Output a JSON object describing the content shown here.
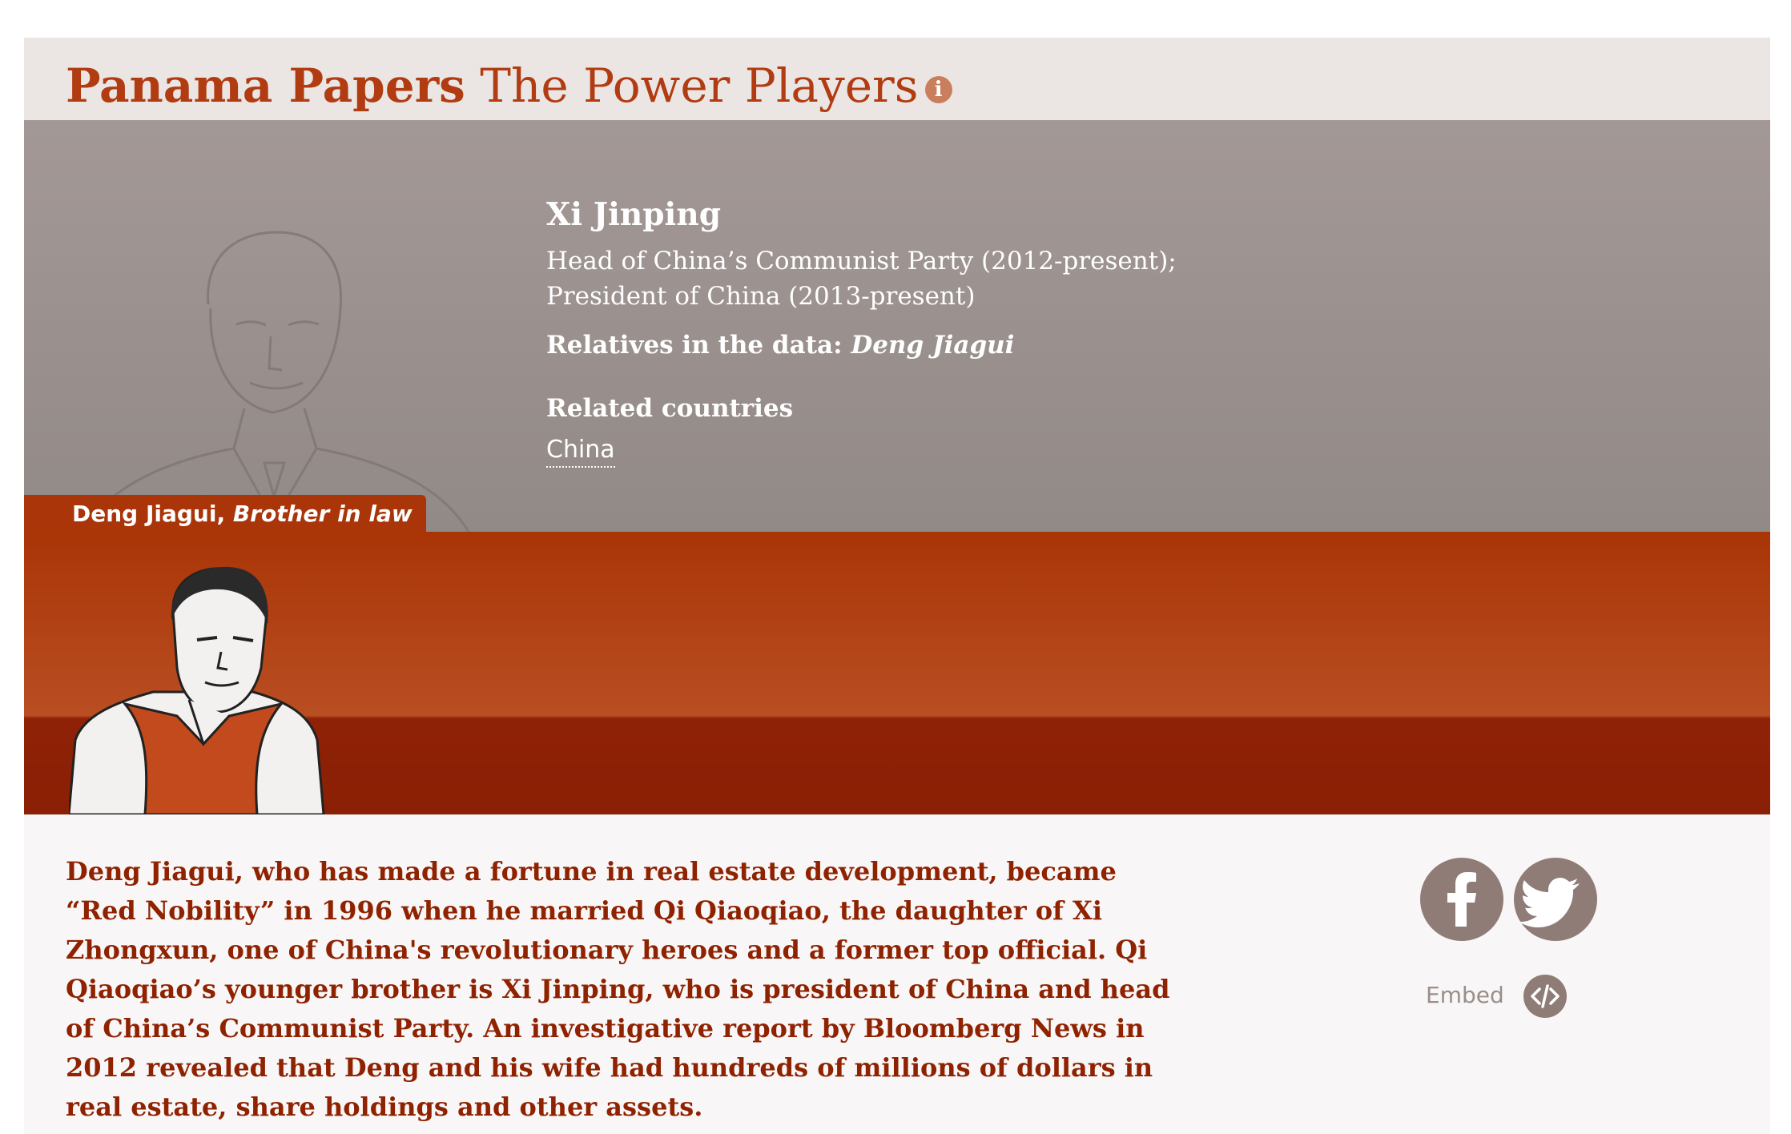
{
  "header": {
    "title_strong": "Panama Papers",
    "title_rest": "The Power Players",
    "info_icon": "info-icon",
    "info_glyph": "i"
  },
  "politician": {
    "name": "Xi Jinping",
    "role": "Head of China’s Communist Party (2012-present); President of China (2013-present)",
    "relatives_label": "Relatives in the data:",
    "relatives_value": "Deng Jiagui",
    "countries_heading": "Related countries",
    "countries": [
      "China"
    ]
  },
  "relative": {
    "name": "Deng Jiagui,",
    "relation": "Brother in law",
    "description": "Deng Jiagui, who has made a fortune in real estate development, became “Red Nobility” in 1996 when he married Qi Qiaoqiao, the daughter of Xi Zhongxun, one of China's revolutionary heroes and a former top official. Qi Qiaoqiao’s younger brother is Xi Jinping, who is president of China and head of China’s Communist Party. An investigative report by Bloomberg News in 2012 revealed that Deng and his wife had hundreds of millions of dollars in real estate, share holdings and other assets."
  },
  "share": {
    "facebook_icon": "facebook-icon",
    "twitter_icon": "twitter-icon",
    "embed_label": "Embed",
    "embed_icon": "code-icon"
  },
  "colors": {
    "accent": "#b23c12",
    "relative_panel": "#a93507",
    "politician_panel": "#9a918e",
    "body_text": "#8f2200",
    "social": "#8f7c77"
  }
}
